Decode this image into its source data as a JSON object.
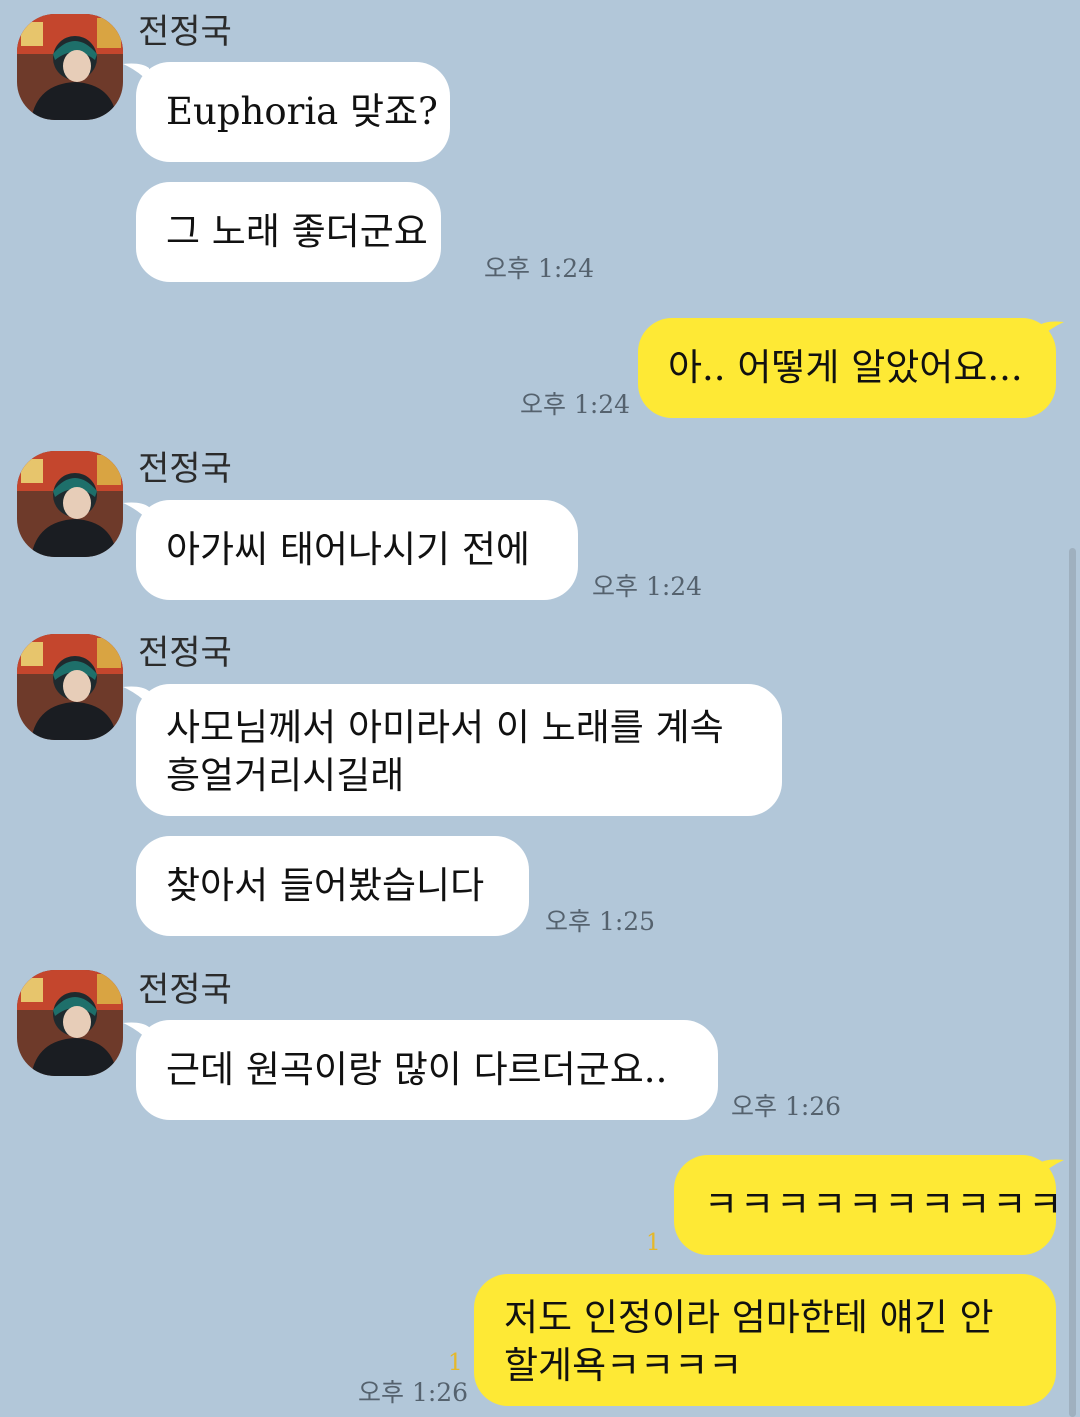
{
  "chat": {
    "sender_name": "전정국",
    "groups": [
      {
        "sender": "전정국",
        "messages": [
          "Euphoria 맞죠?",
          "그 노래 좋더군요"
        ],
        "time": "오후 1:24"
      },
      {
        "mine": true,
        "messages": [
          "아.. 어떻게 알았어요..."
        ],
        "time": "오후 1:24"
      },
      {
        "sender": "전정국",
        "messages": [
          "아가씨 태어나시기 전에"
        ],
        "time": "오후 1:24"
      },
      {
        "sender": "전정국",
        "messages": [
          [
            "사모님께서 아미라서 이 노래를 계속",
            "흥얼거리시길래"
          ],
          "찾아서 들어봤습니다"
        ],
        "time": "오후 1:25"
      },
      {
        "sender": "전정국",
        "messages": [
          "근데 원곡이랑 많이 다르더군요.."
        ],
        "time": "오후 1:26"
      },
      {
        "mine": true,
        "messages": [
          "ㅋㅋㅋㅋㅋㅋㅋㅋㅋㅋ",
          [
            "저도 인정이라 엄마한테 얘긴 안",
            "할게욕ㅋㅋㅋㅋ"
          ]
        ],
        "unread": [
          "1",
          "1"
        ],
        "time": "오후 1:26"
      }
    ]
  },
  "colors": {
    "background": "#b2c7d9",
    "incoming_bubble": "#ffffff",
    "outgoing_bubble": "#fee935",
    "unread_count": "#e5b82a",
    "timestamp": "#55626e"
  },
  "icons": {
    "avatar": "profile-photo-avatar"
  }
}
